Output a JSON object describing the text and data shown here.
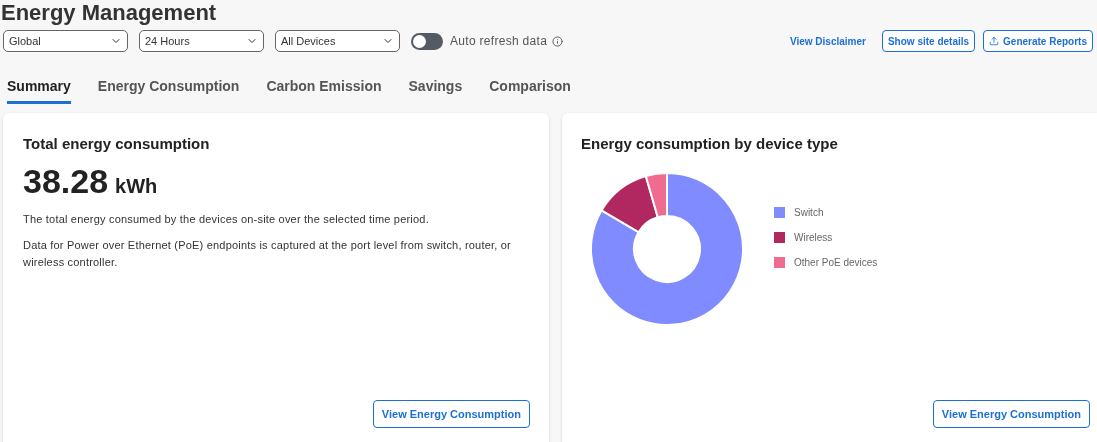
{
  "title": "Energy Management",
  "filters": [
    {
      "value": "Global"
    },
    {
      "value": "24 Hours"
    },
    {
      "value": "All Devices"
    }
  ],
  "auto_refresh": {
    "label": "Auto refresh data",
    "on": false
  },
  "actions": {
    "link": "View Disclaimer",
    "buttons": [
      {
        "label": "Show site details",
        "kind": "plain"
      },
      {
        "label": "Generate Reports",
        "kind": "upload"
      }
    ]
  },
  "tabs": [
    {
      "label": "Summary",
      "selected": true
    },
    {
      "label": "Energy Consumption",
      "selected": false
    },
    {
      "label": "Carbon Emission",
      "selected": false
    },
    {
      "label": "Savings",
      "selected": false
    },
    {
      "label": "Comparison",
      "selected": false
    }
  ],
  "total_card": {
    "title": "Total energy consumption",
    "value": "38.28",
    "unit": "kWh",
    "paragraphs": [
      "The total energy consumed by the devices on-site over the selected time period.",
      "Data for Power over Ethernet (PoE) endpoints is captured at the port level from switch, router, or wireless controller."
    ],
    "button": "View Energy Consumption"
  },
  "device_card": {
    "title": "Energy consumption by device type",
    "legend": [
      {
        "label": "Switch",
        "color": "#7f8bff"
      },
      {
        "label": "Wireless",
        "color": "#b0285f"
      },
      {
        "label": "Other PoE devices",
        "color": "#f06c8f"
      }
    ],
    "button": "View Energy Consumption"
  }
}
